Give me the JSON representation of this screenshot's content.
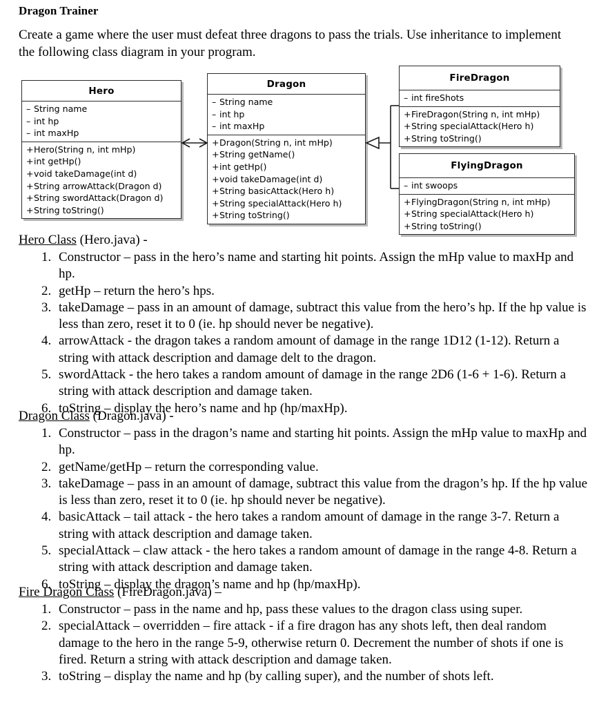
{
  "document": {
    "title": "Dragon Trainer",
    "intro": "Create a game where the user must defeat three dragons to pass the trials.  Use inheritance to implement the following class diagram in your program."
  },
  "class_diagram": {
    "classes": [
      {
        "name": "Hero",
        "attributes": [
          {
            "visibility": "–",
            "text": "String name"
          },
          {
            "visibility": "–",
            "text": "int hp"
          },
          {
            "visibility": "–",
            "text": "int maxHp"
          }
        ],
        "methods": [
          {
            "visibility": "+",
            "text": "Hero(String n, int mHp)"
          },
          {
            "visibility": "+",
            "text": "int getHp()"
          },
          {
            "visibility": "+",
            "text": "void takeDamage(int d)"
          },
          {
            "visibility": "+",
            "text": "String arrowAttack(Dragon d)"
          },
          {
            "visibility": "+",
            "text": "String swordAttack(Dragon d)"
          },
          {
            "visibility": "+",
            "text": "String toString()"
          }
        ]
      },
      {
        "name": "Dragon",
        "attributes": [
          {
            "visibility": "–",
            "text": "String name"
          },
          {
            "visibility": "–",
            "text": "int hp"
          },
          {
            "visibility": "–",
            "text": "int maxHp"
          }
        ],
        "methods": [
          {
            "visibility": "+",
            "text": "Dragon(String n, int mHp)"
          },
          {
            "visibility": "+",
            "text": "String getName()"
          },
          {
            "visibility": "+",
            "text": "int getHp()"
          },
          {
            "visibility": "+",
            "text": "void takeDamage(int d)"
          },
          {
            "visibility": "+",
            "text": "String basicAttack(Hero h)"
          },
          {
            "visibility": "+",
            "text": "String specialAttack(Hero h)"
          },
          {
            "visibility": "+",
            "text": "String toString()"
          }
        ]
      },
      {
        "name": "FireDragon",
        "attributes": [
          {
            "visibility": "–",
            "text": "int fireShots"
          }
        ],
        "methods": [
          {
            "visibility": "+",
            "text": "FireDragon(String n, int mHp)"
          },
          {
            "visibility": "+",
            "text": "String specialAttack(Hero h)"
          },
          {
            "visibility": "+",
            "text": "String toString()"
          }
        ]
      },
      {
        "name": "FlyingDragon",
        "attributes": [
          {
            "visibility": "–",
            "text": "int swoops"
          }
        ],
        "methods": [
          {
            "visibility": "+",
            "text": "FlyingDragon(String n, int mHp)"
          },
          {
            "visibility": "+",
            "text": "String specialAttack(Hero h)"
          },
          {
            "visibility": "+",
            "text": "String toString()"
          }
        ]
      }
    ],
    "relationships": [
      {
        "type": "association",
        "from": "Hero",
        "to": "Dragon",
        "style": "double-arrow"
      },
      {
        "type": "inheritance",
        "from": "FireDragon",
        "to": "Dragon",
        "style": "hollow-triangle"
      },
      {
        "type": "inheritance",
        "from": "FlyingDragon",
        "to": "Dragon",
        "style": "hollow-triangle"
      }
    ]
  },
  "sections": [
    {
      "id": "hero",
      "class_name": "Hero Class",
      "file": " (Hero.java) -",
      "steps": [
        "Constructor – pass in the hero’s name and starting hit points.  Assign the mHp value to maxHp and hp.",
        "getHp – return the hero’s hps.",
        "takeDamage – pass in an amount of damage, subtract this value from the hero’s hp.  If the hp value is less than zero, reset it to 0 (ie. hp should never be negative).",
        "arrowAttack - the dragon takes a random amount of damage in the range 1D12 (1-12).  Return a string with attack description and damage delt to the dragon.",
        "swordAttack - the hero takes a random amount of damage in the range 2D6 (1-6 + 1-6).  Return a string with attack description and damage taken.",
        "toString – display the hero’s name and hp (hp/maxHp)."
      ]
    },
    {
      "id": "dragon",
      "class_name": "Dragon Class",
      "file": " (Dragon.java) -",
      "steps": [
        "Constructor – pass in the dragon’s name and starting hit points.  Assign the mHp value to maxHp and hp.",
        "getName/getHp – return the corresponding value.",
        "takeDamage – pass in an amount of damage, subtract this value from the dragon’s hp.  If the hp value is less than zero, reset it to 0 (ie. hp should never be negative).",
        "basicAttack – tail attack - the hero takes a random amount of damage in the range 3-7.  Return a string with attack description and damage taken.",
        "specialAttack – claw attack - the hero takes a random amount of damage in the range 4-8.  Return a string with attack description and damage taken.",
        "toString – display the dragon’s name and hp (hp/maxHp)."
      ]
    },
    {
      "id": "fire",
      "class_name": "Fire Dragon Class",
      "file": " (FireDragon.java) –",
      "steps": [
        "Constructor – pass in the name and hp, pass these values to the dragon class using super.",
        "specialAttack – overridden – fire attack - if a fire dragon has any shots left, then deal random damage to the hero in the range 5-9, otherwise return 0.  Decrement the number of shots if one is fired.  Return a string with attack description and damage taken.",
        "toString – display the name and hp (by calling super), and the number of shots left."
      ]
    }
  ]
}
